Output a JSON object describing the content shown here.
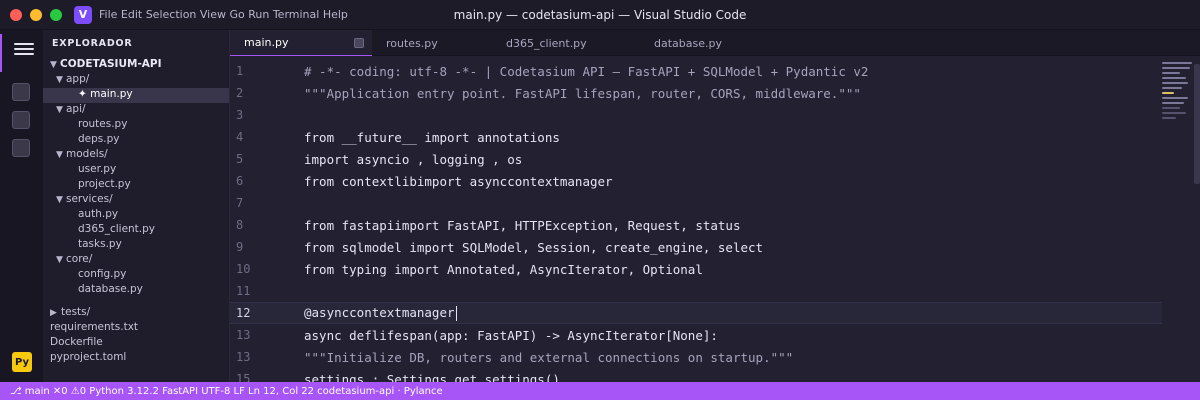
{
  "window": {
    "title": "main.py — codetasium-api — Visual Studio Code",
    "app_logo": "V",
    "menu": "File Edit Selection View Go Run Terminal Help"
  },
  "activity_bar": {
    "language_badge": "Py",
    "accent": "#a855f7"
  },
  "sidebar": {
    "header": "EXPLORADOR",
    "root": "CODETASIUM-API",
    "items": [
      {
        "label": "app/",
        "caret": "▼",
        "indent": 1
      },
      {
        "label": "✦ main.py",
        "caret": "",
        "indent": 2,
        "active": true
      },
      {
        "label": "api/",
        "caret": "▼",
        "indent": 1
      },
      {
        "label": "routes.py",
        "caret": "",
        "indent": 2
      },
      {
        "label": "deps.py",
        "caret": "",
        "indent": 2
      },
      {
        "label": "models/",
        "caret": "▼",
        "indent": 1
      },
      {
        "label": "user.py",
        "caret": "",
        "indent": 2
      },
      {
        "label": "project.py",
        "caret": "",
        "indent": 2
      },
      {
        "label": "services/",
        "caret": "▼",
        "indent": 1
      },
      {
        "label": "auth.py",
        "caret": "",
        "indent": 2
      },
      {
        "label": "d365_client.py",
        "caret": "",
        "indent": 2
      },
      {
        "label": "tasks.py",
        "caret": "",
        "indent": 2
      },
      {
        "label": "core/",
        "caret": "▼",
        "indent": 1
      },
      {
        "label": "config.py",
        "caret": "",
        "indent": 2
      },
      {
        "label": "database.py",
        "caret": "",
        "indent": 2
      }
    ],
    "bottom_items": [
      {
        "label": "tests/",
        "caret": "▶"
      },
      {
        "label": "requirements.txt",
        "caret": ""
      },
      {
        "label": "Dockerfile",
        "caret": ""
      },
      {
        "label": "pyproject.toml",
        "caret": ""
      }
    ]
  },
  "tabs": [
    {
      "label": "main.py",
      "active": true
    },
    {
      "label": "routes.py",
      "active": false
    },
    {
      "label": "d365_client.py",
      "active": false
    },
    {
      "label": "database.py",
      "active": false
    }
  ],
  "editor": {
    "lines": [
      {
        "n": "1",
        "text": "# -*- coding: utf-8 -*- | Codetasium API — FastAPI + SQLModel + Pydantic v2",
        "comment": true
      },
      {
        "n": "2",
        "text": "\"\"\"Application entry point. FastAPI lifespan, router, CORS, middleware.\"\"\"",
        "comment": true
      },
      {
        "n": "3",
        "text": ""
      },
      {
        "n": "4",
        "text": "from __future__ import annotations"
      },
      {
        "n": "5",
        "text": "import asyncio , logging , os"
      },
      {
        "n": "6",
        "text": "from contextlibimport asynccontextmanager"
      },
      {
        "n": "7",
        "text": ""
      },
      {
        "n": "8",
        "text": "from fastapiimport FastAPI, HTTPException, Request, status"
      },
      {
        "n": "9",
        "text": "from sqlmodel import SQLModel, Session, create_engine, select"
      },
      {
        "n": "10",
        "text": "from typing import Annotated, AsyncIterator, Optional"
      },
      {
        "n": "11",
        "text": ""
      },
      {
        "n": "12",
        "text": "@asynccontextmanager",
        "current": true
      },
      {
        "n": "13",
        "text": "async deflifespan(app: FastAPI) -> AsyncIterator[None]:"
      },
      {
        "n": "13",
        "text": "\"\"\"Initialize DB, routers and external connections on startup.\"\"\"",
        "comment": true
      },
      {
        "n": "15",
        "text": "settings : Settings get_settings()"
      }
    ]
  },
  "statusbar": {
    "text": "⎇ main ✕0 ⚠0 Python 3.12.2 FastAPI UTF-8 LF Ln 12, Col 22 codetasium-api · Pylance"
  }
}
